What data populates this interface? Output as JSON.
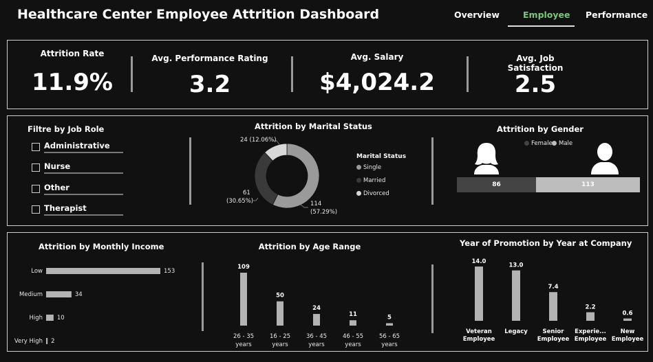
{
  "header": {
    "title": "Healthcare Center Employee Attrition Dashboard",
    "tabs": [
      {
        "label": "Overview",
        "active": false
      },
      {
        "label": "Employee",
        "active": true
      },
      {
        "label": "Performance",
        "active": false
      }
    ]
  },
  "kpis": [
    {
      "label": "Attrition Rate",
      "value": "11.9%"
    },
    {
      "label": "Avg. Performance Rating",
      "value": "3.2"
    },
    {
      "label": "Avg. Salary",
      "value": "$4,024.2"
    },
    {
      "label": "Avg. Job Satisfaction",
      "value": "2.5"
    }
  ],
  "filter": {
    "title": "Filtre by Job Role",
    "items": [
      "Administrative",
      "Nurse",
      "Other",
      "Therapist"
    ]
  },
  "marital": {
    "title": "Attrition by Marital Status",
    "legend_title": "Marital Status",
    "legend": [
      {
        "name": "Single",
        "color": "#9a9a9a"
      },
      {
        "name": "Married",
        "color": "#3a3a3a"
      },
      {
        "name": "Divorced",
        "color": "#d8d8d8"
      }
    ],
    "labels": [
      {
        "text1": "24 (12.06%)",
        "text2": ""
      },
      {
        "text1": "61",
        "text2": "(30.65%)"
      },
      {
        "text1": "114",
        "text2": "(57.29%)"
      }
    ]
  },
  "gender": {
    "title": "Attrition by Gender",
    "legend": [
      {
        "name": "Female",
        "color": "#444444"
      },
      {
        "name": "Male",
        "color": "#bdbdbd"
      }
    ],
    "female_value": "86",
    "male_value": "113"
  },
  "colors": {
    "bar": "#b3b3b3",
    "background": "#111111",
    "accent_tab": "#7ec47e"
  },
  "chart_data": [
    {
      "type": "pie",
      "title": "Attrition by Marital Status",
      "categories": [
        "Single",
        "Married",
        "Divorced"
      ],
      "values": [
        114,
        61,
        24
      ],
      "percents": [
        57.29,
        30.65,
        12.06
      ]
    },
    {
      "type": "bar",
      "title": "Attrition by Gender",
      "categories": [
        "Female",
        "Male"
      ],
      "values": [
        86,
        113
      ]
    },
    {
      "type": "bar",
      "orientation": "horizontal",
      "title": "Attrition by Monthly Income",
      "categories": [
        "Low",
        "Medium",
        "High",
        "Very High"
      ],
      "values": [
        153,
        34,
        10,
        2
      ]
    },
    {
      "type": "bar",
      "title": "Attrition by Age Range",
      "categories": [
        "26 - 35 years",
        "16 - 25 years",
        "36 - 45 years",
        "46 - 55 years",
        "56 - 65 years"
      ],
      "category_lines": [
        [
          "26 - 35",
          "years"
        ],
        [
          "16 - 25",
          "years"
        ],
        [
          "36 - 45",
          "years"
        ],
        [
          "46 - 55",
          "years"
        ],
        [
          "56 - 65",
          "years"
        ]
      ],
      "values": [
        109,
        50,
        24,
        11,
        5
      ]
    },
    {
      "type": "bar",
      "title": "Year of Promotion by Year at Company",
      "categories": [
        "Veteran Employee",
        "Legacy",
        "Senior Employee",
        "Experie... Employee",
        "New Employee"
      ],
      "category_lines": [
        [
          "Veteran",
          "Employee"
        ],
        [
          "Legacy",
          ""
        ],
        [
          "Senior",
          "Employee"
        ],
        [
          "Experie...",
          "Employee"
        ],
        [
          "New",
          "Employee"
        ]
      ],
      "values": [
        "14.0",
        "13.0",
        "7.4",
        "2.2",
        "0.6"
      ]
    }
  ]
}
